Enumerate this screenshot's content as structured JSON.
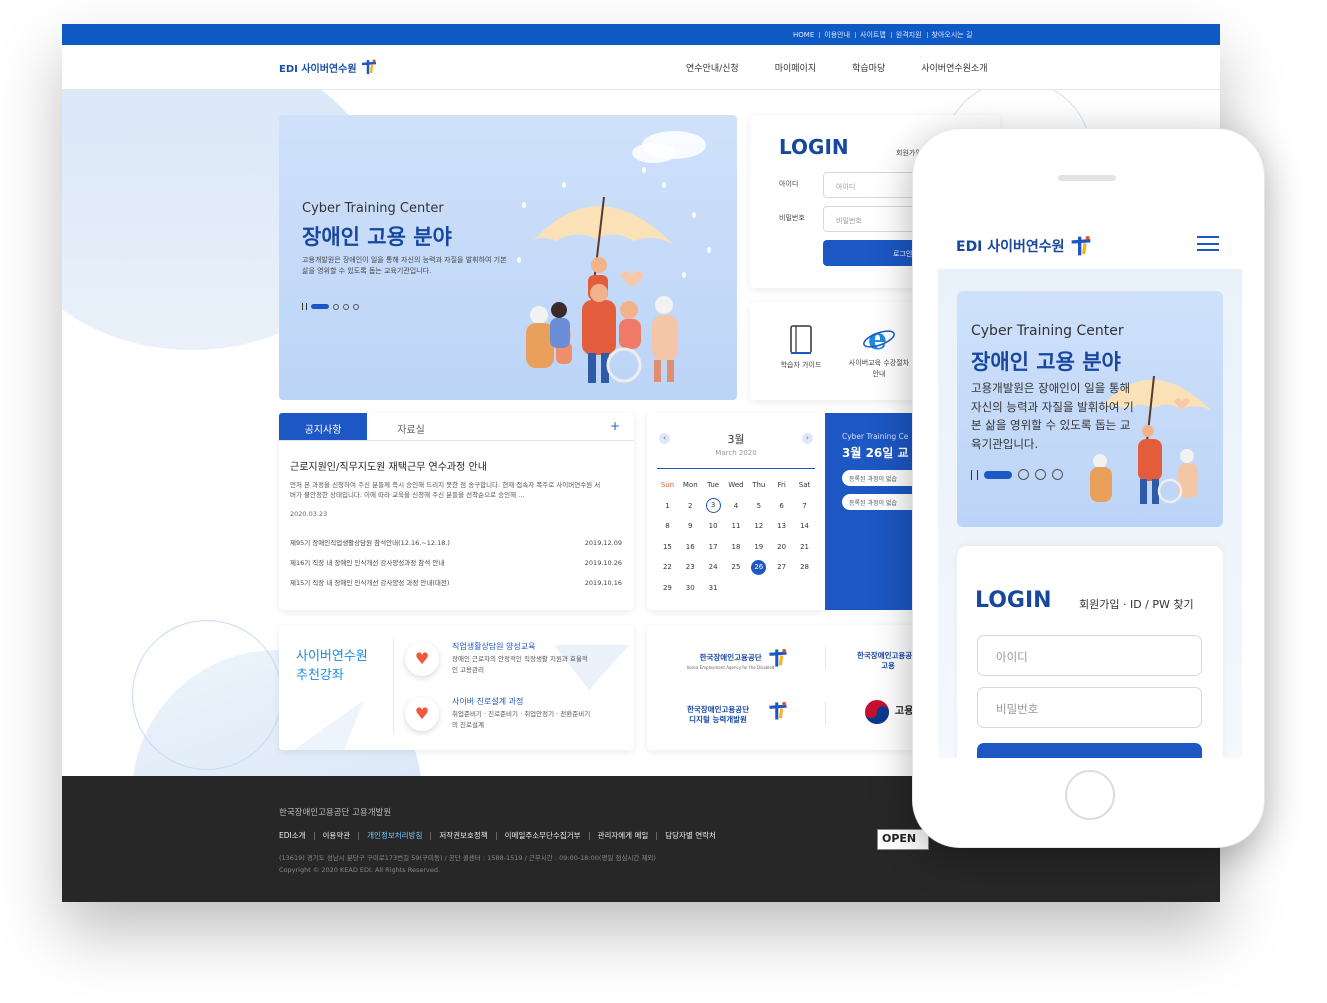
{
  "util_nav": [
    "HOME",
    "이용안내",
    "사이트맵",
    "원격지원",
    "찾아오시는 길"
  ],
  "brand": {
    "name": "EDI 사이버연수원"
  },
  "gnb": [
    "연수안내/신청",
    "마이페이지",
    "학습마당",
    "사이버연수원소개"
  ],
  "hero": {
    "title_en": "Cyber Training Center",
    "title_ko": "장애인 고용 분야",
    "desc": "고용개발원은 장애인이 일을 통해 자신의 능력과 자질을 발휘하여 기본 삶을 영위할 수 있도록 돕는 교육기관입니다."
  },
  "login": {
    "title": "LOGIN",
    "join_links": "회원가입",
    "id_label": "아이디",
    "id_placeholder": "아이디",
    "pw_label": "비밀번호",
    "pw_placeholder": "비밀번호",
    "button": "로그인"
  },
  "quick": [
    {
      "label": "학습자 가이드",
      "icon": "book-icon"
    },
    {
      "label": "사이버교육 수강절차안내",
      "icon": "ie-browser-icon"
    }
  ],
  "board": {
    "tabs": [
      "공지사항",
      "자료실"
    ],
    "more": "+",
    "featured_title": "근로지원인/직무지도원 재택근무 연수과정 안내",
    "featured_text": "먼저 본 과정을 신청하여 주신 분들께 즉시 승인해 드리지 못한 점 송구합니다. 현재 접속자 폭주로 사이버연수원 서버가 불안정한 상태입니다. 이에 따라 교육을 신청해 주신 분들을 선착순으로 승인해 ...",
    "featured_date": "2020.03.23",
    "items": [
      {
        "title": "제95기 장애인직업생활상담원 참석안내(12.16.~12.18.)",
        "date": "2019.12.09"
      },
      {
        "title": "제16기 직장 내 장애인 인식개선 강사양성과정 참석 안내",
        "date": "2019.10.26"
      },
      {
        "title": "제15기 직장 내 장애인 인식개선 강사양성 과정 안내(대전)",
        "date": "2019.10.16"
      }
    ]
  },
  "calendar": {
    "month_ko": "3월",
    "month_en": "March 2020",
    "weekdays": [
      "Sun",
      "Mon",
      "Tue",
      "Wed",
      "Thu",
      "Fri",
      "Sat"
    ],
    "weeks": [
      [
        "1",
        "2",
        "3",
        "4",
        "5",
        "6",
        "7"
      ],
      [
        "8",
        "9",
        "10",
        "11",
        "12",
        "13",
        "14"
      ],
      [
        "15",
        "16",
        "17",
        "18",
        "19",
        "20",
        "21"
      ],
      [
        "22",
        "23",
        "24",
        "25",
        "26",
        "27",
        "28"
      ],
      [
        "29",
        "30",
        "31",
        "",
        "",
        "",
        ""
      ]
    ],
    "today": "3",
    "selected": "26",
    "side_en": "Cyber Training Ce",
    "side_date": "3월 26일 교",
    "side_items": [
      "등록된 과정이 없습",
      "등록된 과정이 없습"
    ]
  },
  "recommend": {
    "heading_line1": "사이버연수원",
    "heading_line2": "추천강좌",
    "courses": [
      {
        "title": "직업생활상담원 양성교육",
        "desc": "장애인 근로자의 안정적인 직장생활 지원과 효율적인 고용관리",
        "icon": "heart-icon"
      },
      {
        "title": "사이버 진로설계 과정",
        "desc": "취업준비기 · 진로준비기 · 취업안정기 · 전환준비기의 진로설계",
        "icon": "heart-icon"
      }
    ]
  },
  "partners": [
    {
      "name": "한국장애인고용공단",
      "sub": "Korea Employment Agency for the Disabled"
    },
    {
      "name": "한국장애인고용공단",
      "sub": "고용"
    },
    {
      "name": "한국장애인고용공단",
      "sub": "디지털 능력개발원"
    },
    {
      "name": "고용",
      "sub": ""
    }
  ],
  "footer": {
    "org": "한국장애인고용공단 고용개발원",
    "links": [
      "EDI소개",
      "이용약관",
      "개인정보처리방침",
      "저작권보호정책",
      "이메일주소무단수집거부",
      "관리자에게 메일",
      "담당자별 연락처"
    ],
    "address": "(13619) 경기도 성남시 분당구 구미로173번길 59(구미동) / 공단 콜센터 : 1588-1519 / 근무시간 : 09:00-18:00(평일 점심시간 제외)",
    "copyright": "Copyright © 2020 KEAD EDI. All Rights Reserved.",
    "badge": "OPEN"
  },
  "mobile": {
    "brand": "EDI 사이버연수원",
    "hero_en": "Cyber Training Center",
    "hero_ko": "장애인 고용 분야",
    "hero_desc": "고용개발원은 장애인이 일을 통해 자신의 능력과 자질을 발휘하여 기본 삶을 영위할 수 있도록 돕는 교육기관입니다.",
    "login_title": "LOGIN",
    "login_links": "회원가입 · ID / PW 찾기",
    "id_placeholder": "아이디",
    "pw_placeholder": "비밀번호"
  },
  "colors": {
    "primary": "#1c57c4",
    "brand_dark": "#1847a0",
    "accent_heart": "#f05a3b",
    "footer_bg": "#272727"
  }
}
